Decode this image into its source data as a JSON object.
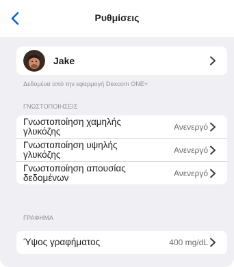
{
  "nav": {
    "title": "Ρυθμίσεις"
  },
  "profile": {
    "name": "Jake",
    "source_caption": "Δεδομένα από την εφαρμογή Dexcom ONE+"
  },
  "notifications": {
    "section_title": "ΓΝΩΣΤΟΠΟΙΗΣΕΙΣ",
    "items": [
      {
        "label": "Γνωστοποίηση χαμηλής γλυκόζης",
        "value": "Ανενεργό"
      },
      {
        "label": "Γνωστοποίηση υψηλής γλυκόζης",
        "value": "Ανενεργό"
      },
      {
        "label": "Γνωστοποίηση απουσίας δεδομένων",
        "value": "Ανενεργό"
      }
    ]
  },
  "graph": {
    "section_title": "ΓΡΑΦΗΜΑ",
    "items": [
      {
        "label": "Ύψος γραφήματος",
        "value": "400 mg/dL"
      }
    ]
  },
  "colors": {
    "accent": "#0a5fc2",
    "background": "#efeff4",
    "card": "#ffffff",
    "secondary_text": "#8e8e93"
  },
  "icons": {
    "back": "chevron-left-icon",
    "disclosure": "chevron-right-icon",
    "avatar": "avatar-photo"
  }
}
